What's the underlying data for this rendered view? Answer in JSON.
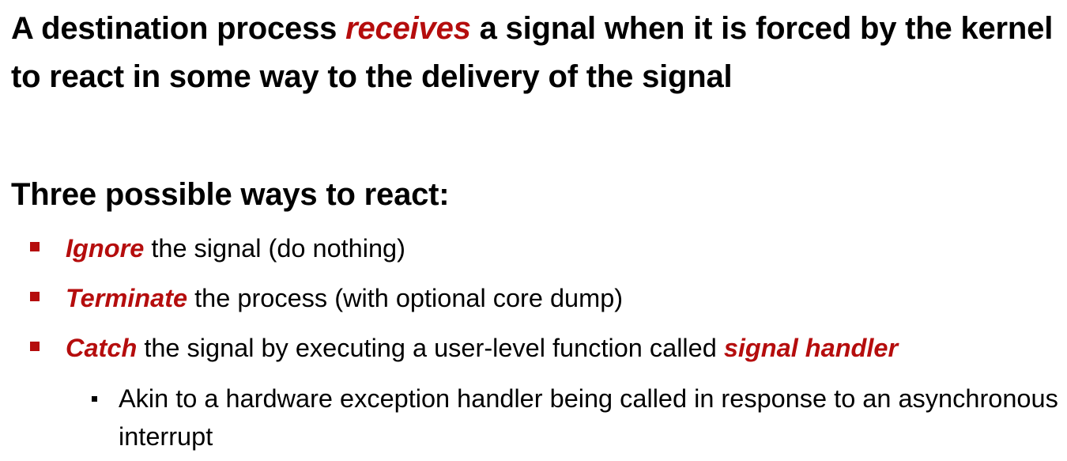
{
  "slide": {
    "para1": {
      "before": "A destination process ",
      "emphasis": "receives",
      "after": " a signal when it is forced by the kernel to react in some way to the delivery of the signal"
    },
    "para2": {
      "text": "Three possible ways to react:"
    },
    "bullets": [
      {
        "emphasis": "Ignore",
        "text": " the signal (do nothing)"
      },
      {
        "emphasis": "Terminate",
        "text": " the process (with optional core dump)"
      },
      {
        "emphasis": "Catch",
        "text": " the signal by executing a user-level function called ",
        "emphasis2": "signal handler"
      }
    ],
    "sub_bullet": {
      "text": "Akin to a hardware exception handler being called in response to an asynchronous interrupt"
    }
  },
  "colors": {
    "emphasis": "#b50d0d",
    "text": "#000000",
    "bullet_square": "#b50d0d",
    "sub_bullet_square": "#000000"
  }
}
